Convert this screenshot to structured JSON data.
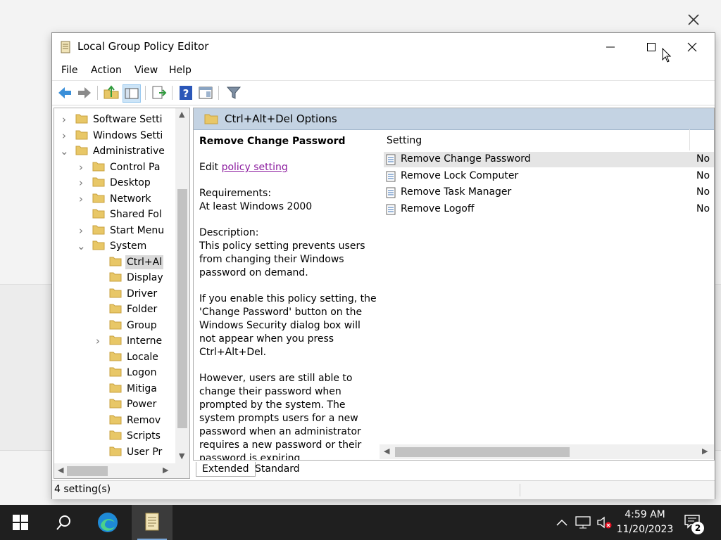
{
  "window": {
    "title": "Local Group Policy Editor"
  },
  "menu": [
    "File",
    "Action",
    "View",
    "Help"
  ],
  "tree": [
    {
      "label": "Software Setti",
      "depth": 0,
      "expander": "collapsed"
    },
    {
      "label": "Windows Setti",
      "depth": 0,
      "expander": "collapsed"
    },
    {
      "label": "Administrative",
      "depth": 0,
      "expander": "expanded"
    },
    {
      "label": "Control Pa",
      "depth": 1,
      "expander": "collapsed"
    },
    {
      "label": "Desktop",
      "depth": 1,
      "expander": "collapsed"
    },
    {
      "label": "Network",
      "depth": 1,
      "expander": "collapsed"
    },
    {
      "label": "Shared Fol",
      "depth": 1,
      "expander": "none"
    },
    {
      "label": "Start Menu",
      "depth": 1,
      "expander": "collapsed"
    },
    {
      "label": "System",
      "depth": 1,
      "expander": "expanded"
    },
    {
      "label": "Ctrl+Al",
      "depth": 2,
      "expander": "none",
      "selected": true
    },
    {
      "label": "Display",
      "depth": 2,
      "expander": "none"
    },
    {
      "label": "Driver",
      "depth": 2,
      "expander": "none"
    },
    {
      "label": "Folder",
      "depth": 2,
      "expander": "none"
    },
    {
      "label": "Group",
      "depth": 2,
      "expander": "none"
    },
    {
      "label": "Interne",
      "depth": 2,
      "expander": "collapsed"
    },
    {
      "label": "Locale",
      "depth": 2,
      "expander": "none"
    },
    {
      "label": "Logon",
      "depth": 2,
      "expander": "none"
    },
    {
      "label": "Mitiga",
      "depth": 2,
      "expander": "none"
    },
    {
      "label": "Power",
      "depth": 2,
      "expander": "none"
    },
    {
      "label": "Remov",
      "depth": 2,
      "expander": "none"
    },
    {
      "label": "Scripts",
      "depth": 2,
      "expander": "none"
    },
    {
      "label": "User Pr",
      "depth": 2,
      "expander": "none"
    }
  ],
  "pane": {
    "header": "Ctrl+Alt+Del Options",
    "desc_title": "Remove Change Password",
    "edit_prefix": "Edit ",
    "edit_link": "policy setting ",
    "req_label": "Requirements:",
    "req_value": "At least Windows 2000",
    "desc_label": "Description:",
    "desc_p1": "This policy setting prevents users from changing their Windows password on demand.",
    "desc_p2": "If you enable this policy setting, the 'Change Password' button on the Windows Security dialog box will not appear when you press Ctrl+Alt+Del.",
    "desc_p3": "However, users are still able to change their password when prompted by the system. The system prompts users for a new password when an administrator requires a new password or their password is expiring.",
    "column_setting": "Setting",
    "rows": [
      {
        "name": "Remove Change Password",
        "state": "No",
        "highlighted": true
      },
      {
        "name": "Remove Lock Computer",
        "state": "No"
      },
      {
        "name": "Remove Task Manager",
        "state": "No"
      },
      {
        "name": "Remove Logoff",
        "state": "No"
      }
    ]
  },
  "tabs": [
    "Extended",
    "Standard"
  ],
  "status": {
    "text": "4 setting(s)"
  },
  "taskbar": {
    "time": "4:59 AM",
    "date": "11/20/2023",
    "notifications": "2"
  },
  "colors": {
    "folder": "#e8c767",
    "pane_header": "#c4d3e3",
    "link": "#8b1a9e",
    "taskbar": "#1f1f1f"
  }
}
